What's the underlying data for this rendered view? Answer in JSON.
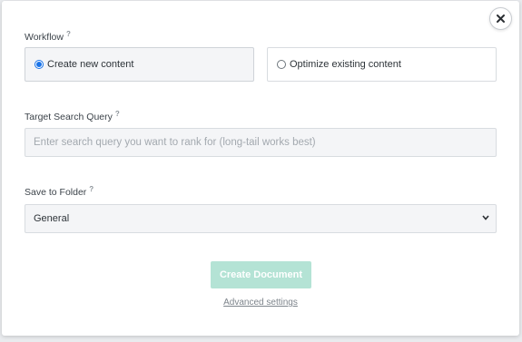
{
  "backdrop": {
    "left_text": "• ...",
    "mid_text": "...",
    "right_text": "..."
  },
  "modal": {
    "close_icon": "close-icon",
    "workflow": {
      "label": "Workflow",
      "help": "?",
      "options": [
        {
          "label": "Create new content",
          "selected": true
        },
        {
          "label": "Optimize existing content",
          "selected": false
        }
      ]
    },
    "query": {
      "label": "Target Search Query",
      "help": "?",
      "value": "",
      "placeholder": "Enter search query you want to rank for (long-tail works best)"
    },
    "folder": {
      "label": "Save to Folder",
      "help": "?",
      "selected": "General",
      "chevron_icon": "chevron-down-icon"
    },
    "create_button": "Create Document",
    "advanced_link": "Advanced settings",
    "colors": {
      "primary_disabled": "#b4e3d5",
      "radio_accent": "#1a73e8"
    }
  }
}
